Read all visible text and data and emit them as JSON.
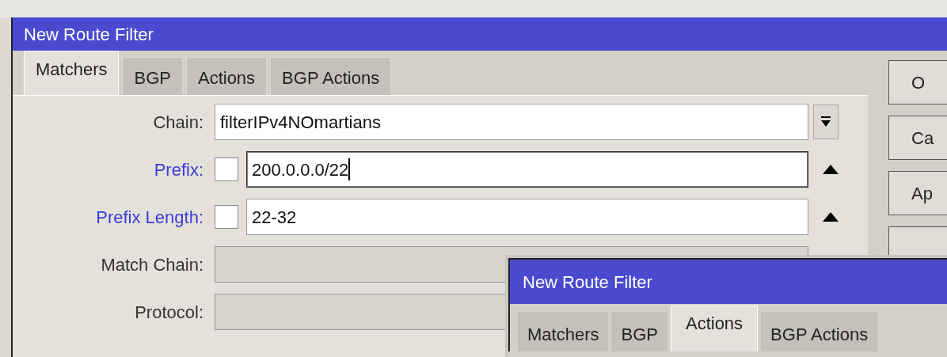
{
  "window": {
    "title": "New Route Filter"
  },
  "tabs": [
    {
      "label": "Matchers",
      "selected": true
    },
    {
      "label": "BGP",
      "selected": false
    },
    {
      "label": "Actions",
      "selected": false
    },
    {
      "label": "BGP Actions",
      "selected": false
    }
  ],
  "fields": [
    {
      "kind": "dropdown",
      "label": "Chain:",
      "value": "filterIPv4NOmartians"
    },
    {
      "kind": "negatable",
      "label": "Prefix:",
      "checked": false,
      "value": "200.0.0.0/22",
      "focused": true
    },
    {
      "kind": "negatable",
      "label": "Prefix Length:",
      "checked": false,
      "value": "22-32",
      "focused": false
    },
    {
      "kind": "disabled",
      "label": "Match Chain:"
    },
    {
      "kind": "disabled",
      "label": "Protocol:"
    }
  ],
  "buttons": [
    {
      "kind": "labeled",
      "label": "O"
    },
    {
      "kind": "labeled",
      "label": "Ca"
    },
    {
      "kind": "labeled",
      "label": "Ap"
    },
    {
      "kind": "covered"
    }
  ],
  "second_window": {
    "title": "New Route Filter",
    "tabs": [
      {
        "label": "Matchers",
        "selected": false
      },
      {
        "label": "BGP",
        "selected": false
      },
      {
        "label": "Actions",
        "selected": true
      },
      {
        "label": "BGP Actions",
        "selected": false
      }
    ]
  }
}
